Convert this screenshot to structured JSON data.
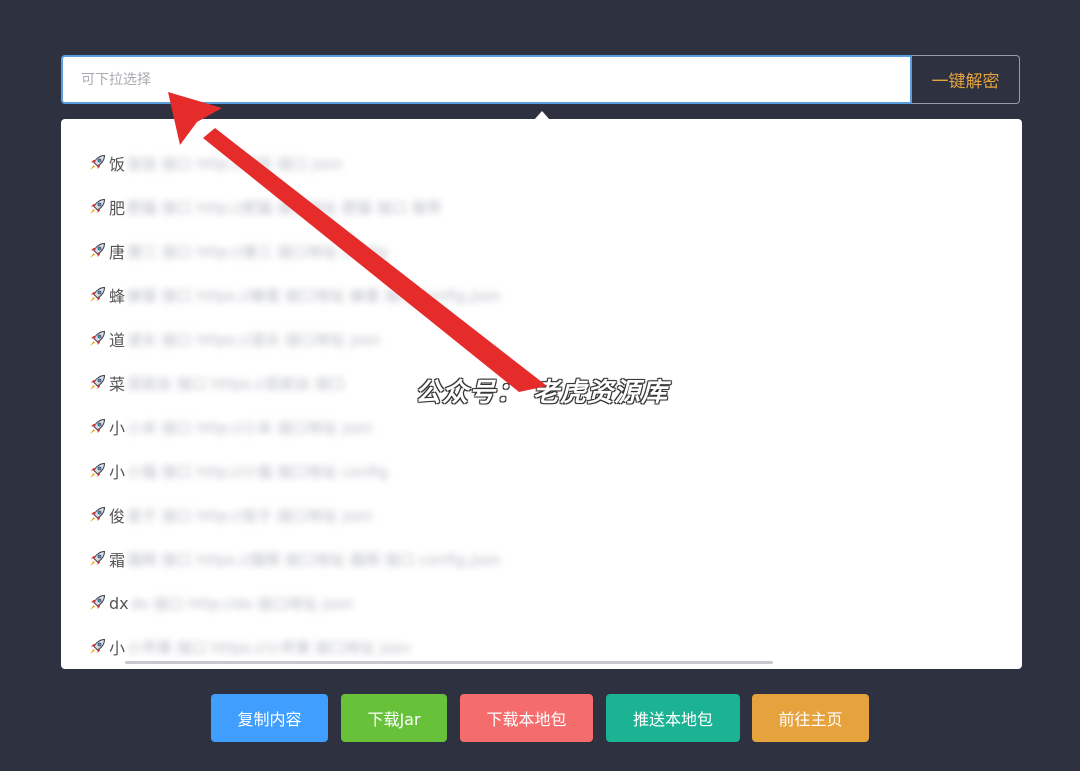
{
  "search": {
    "placeholder": "可下拉选择"
  },
  "decrypt_button": {
    "label": "一键解密"
  },
  "dropdown": {
    "items": [
      {
        "prefix": "饭",
        "hidden": "饭饭 接口 http://饭饭 接口 json"
      },
      {
        "prefix": "肥",
        "hidden": "肥猫 接口 http://肥猫 接口地址 肥猫 接口 推荐"
      },
      {
        "prefix": "唐",
        "hidden": "唐三 接口 http://唐三 接口地址 config"
      },
      {
        "prefix": "蜂",
        "hidden": "蜂蜜 接口 https://蜂蜜 接口地址 蜂蜜 接口 config.json"
      },
      {
        "prefix": "道",
        "hidden": "道长 接口 https://道长 接口地址 json"
      },
      {
        "prefix": "菜",
        "hidden": "菜妮丝 接口 https://菜妮丝 接口"
      },
      {
        "prefix": "小",
        "hidden": "小米 接口 http://小米 接口地址 json"
      },
      {
        "prefix": "小",
        "hidden": "小猫 接口 http://小猫 接口地址 config"
      },
      {
        "prefix": "俊",
        "hidden": "俊于 接口 http://俊于 接口地址 json"
      },
      {
        "prefix": "霜",
        "hidden": "霜辉 接口 https://霜辉 接口地址 霜辉 接口 config.json"
      },
      {
        "prefix": "dx",
        "hidden": "dx 接口 http://dx 接口地址 json"
      },
      {
        "prefix": "小",
        "hidden": "小苹果 接口 https://小苹果 接口地址 json"
      }
    ]
  },
  "watermark": {
    "text": "公众号： 老虎资源库"
  },
  "action_buttons": {
    "copy": "复制内容",
    "download_jar": "下载Jar",
    "download_local": "下载本地包",
    "push_local": "推送本地包",
    "go_home": "前往主页"
  },
  "colors": {
    "background": "#2d3140",
    "accent_orange": "#e6a23c",
    "copy": "#409eff",
    "download_jar": "#67c23a",
    "download_local": "#f56c6c",
    "push_local": "#1bb394",
    "go_home": "#e6a23c",
    "annotation_arrow": "#e62b2b"
  },
  "icons": {
    "option_icon": "rocket-icon"
  }
}
